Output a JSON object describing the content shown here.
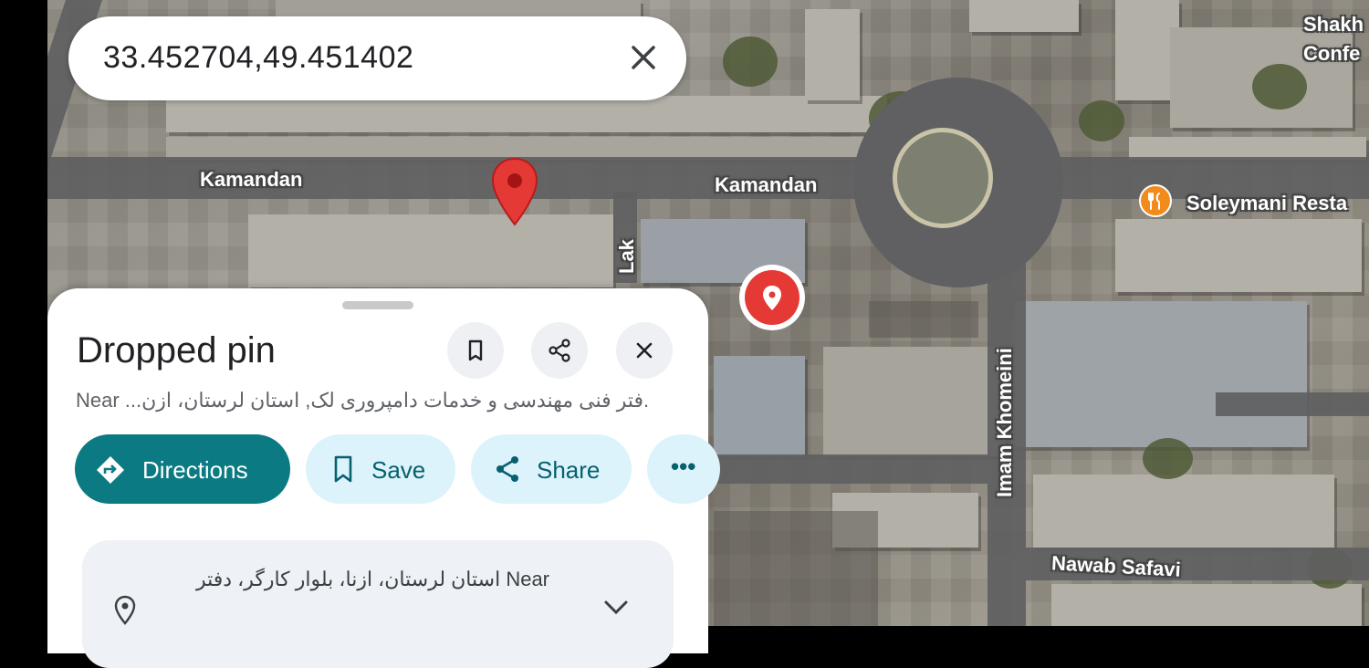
{
  "search": {
    "query": "33.452704,49.451402"
  },
  "map": {
    "street_labels": {
      "kamandan_left": "Kamandan",
      "kamandan_right": "Kamandan",
      "lak": "Lak",
      "imam_khomeini": "Imam Khomeini",
      "nawab_safavi": "Nawab Safavi",
      "shakh": "Shakh",
      "confe": "Confe",
      "soleymani": "Soleymani Resta"
    }
  },
  "sheet": {
    "title": "Dropped pin",
    "subtitle": "Near ...فتر فنی مهندسی و خدمات دامپروری لک, استان لرستان، ازن.",
    "actions": {
      "directions": "Directions",
      "save": "Save",
      "share": "Share",
      "more": "•••"
    },
    "info_card": {
      "line1": "استان لرستان، ازنا، بلوار کارگر، دفتر Near"
    }
  },
  "colors": {
    "accent": "#0b7a82",
    "chip_bg": "#dcf3fb",
    "pin_red": "#e53935"
  }
}
